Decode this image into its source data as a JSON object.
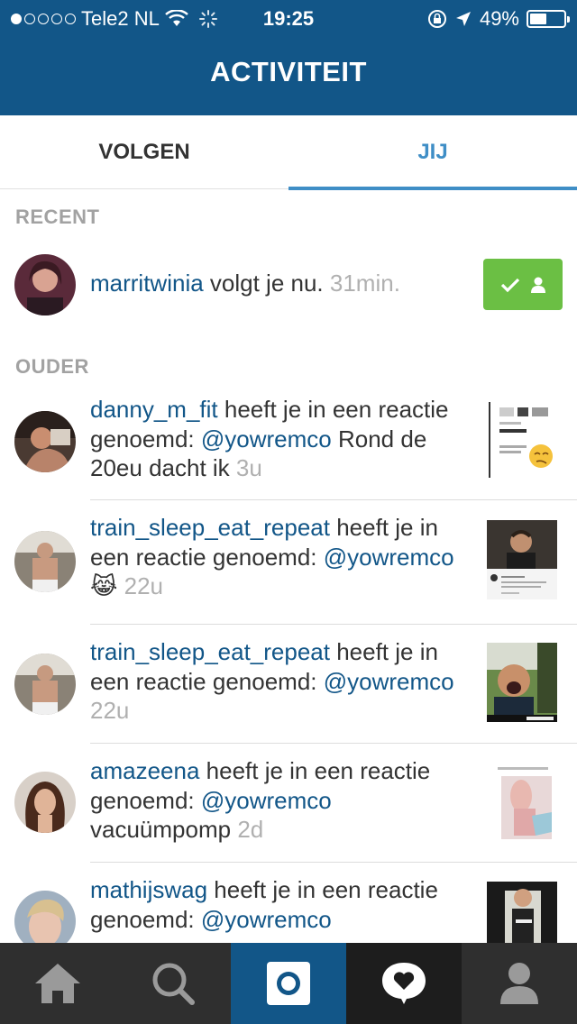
{
  "status_bar": {
    "carrier": "Tele2 NL",
    "time": "19:25",
    "battery": "49%",
    "battery_level": 0.49
  },
  "header": {
    "title": "ACTIVITEIT"
  },
  "tabs": [
    {
      "label": "VOLGEN",
      "active": false
    },
    {
      "label": "JIJ",
      "active": true
    }
  ],
  "sections": {
    "recent": "RECENT",
    "older": "OUDER"
  },
  "recent": {
    "user": "marritwinia",
    "action": " volgt je nu. ",
    "time": "31min."
  },
  "older": [
    {
      "user": "danny_m_fit",
      "action": " heeft je in een reactie genoemd: ",
      "mention": "@yowremco",
      "comment": " Rond de 20eu dacht ik ",
      "time": "3u"
    },
    {
      "user": "train_sleep_eat_repeat",
      "action": " heeft je in een reactie genoemd: ",
      "mention": "@yowremco",
      "comment": " 😹 ",
      "time": "22u"
    },
    {
      "user": "train_sleep_eat_repeat",
      "action": " heeft je in een reactie genoemd: ",
      "mention": "@yowremco",
      "comment": " ",
      "time": "22u"
    },
    {
      "user": "amazeena",
      "action": " heeft je in een reactie genoemd: ",
      "mention": "@yowremco",
      "comment": " vacuümpomp ",
      "time": "2d"
    },
    {
      "user": "mathijswag",
      "action": " heeft je in een reactie genoemd: ",
      "mention": "@yowremco",
      "comment": "",
      "time": ""
    }
  ],
  "nav": [
    "home-icon",
    "search-icon",
    "camera-icon",
    "activity-icon",
    "profile-icon"
  ],
  "colors": {
    "header": "#125688",
    "active_tab": "#3f8ec6",
    "follow_button": "#6bbf44",
    "nav_bar": "#2f2f2f"
  }
}
